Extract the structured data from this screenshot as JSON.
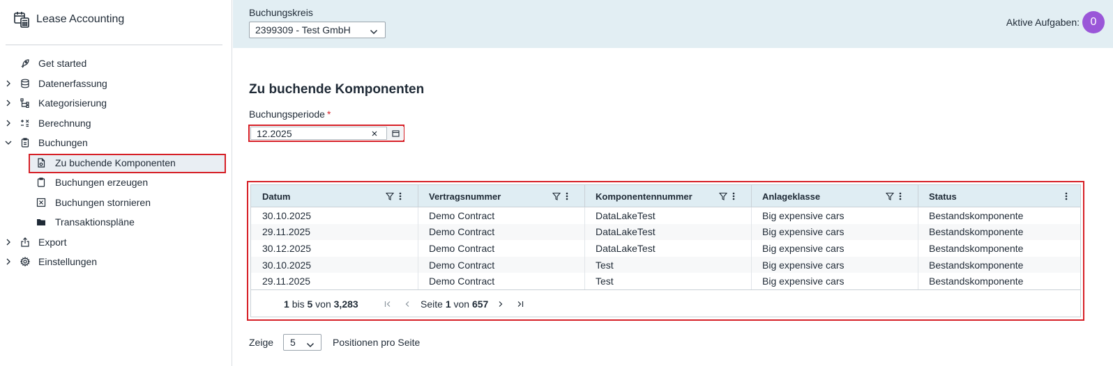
{
  "app": {
    "title": "Lease Accounting"
  },
  "sidebar": {
    "items": [
      {
        "label": "Get started",
        "icon": "rocket-icon",
        "expandable": false
      },
      {
        "label": "Datenerfassung",
        "icon": "database-icon",
        "expandable": true
      },
      {
        "label": "Kategorisierung",
        "icon": "hierarchy-icon",
        "expandable": true
      },
      {
        "label": "Berechnung",
        "icon": "calculator-icon",
        "expandable": true
      },
      {
        "label": "Buchungen",
        "icon": "clipboard-icon",
        "expandable": true,
        "expanded": true,
        "children": [
          {
            "label": "Zu buchende Komponenten",
            "icon": "document-icon",
            "active": true
          },
          {
            "label": "Buchungen erzeugen",
            "icon": "clipboard-icon"
          },
          {
            "label": "Buchungen stornieren",
            "icon": "x-square-icon"
          },
          {
            "label": "Transaktionspläne",
            "icon": "folder-icon"
          }
        ]
      },
      {
        "label": "Export",
        "icon": "upload-icon",
        "expandable": true
      },
      {
        "label": "Einstellungen",
        "icon": "gear-icon",
        "expandable": true
      }
    ]
  },
  "topbar": {
    "company_code_label": "Buchungskreis",
    "company_code_value": "2399309 - Test GmbH",
    "tasks_label": "Aktive Aufgaben:",
    "tasks_count": "0",
    "bg_color": "#e2eef3",
    "badge_color": "#9a56d8"
  },
  "main": {
    "title": "Zu buchende Komponenten",
    "period_label": "Buchungsperiode",
    "period_required_mark": "*",
    "period_value": "12.2025",
    "table": {
      "columns": [
        "Datum",
        "Vertragsnummer",
        "Komponentennummer",
        "Anlageklasse",
        "Status"
      ],
      "rows": [
        [
          "30.10.2025",
          "Demo Contract",
          "DataLakeTest",
          "Big expensive cars",
          "Bestandskomponente"
        ],
        [
          "29.11.2025",
          "Demo Contract",
          "DataLakeTest",
          "Big expensive cars",
          "Bestandskomponente"
        ],
        [
          "30.12.2025",
          "Demo Contract",
          "DataLakeTest",
          "Big expensive cars",
          "Bestandskomponente"
        ],
        [
          "30.10.2025",
          "Demo Contract",
          "Test",
          "Big expensive cars",
          "Bestandskomponente"
        ],
        [
          "29.11.2025",
          "Demo Contract",
          "Test",
          "Big expensive cars",
          "Bestandskomponente"
        ]
      ],
      "footer": {
        "from": "1",
        "bis": "bis",
        "to": "5",
        "von": "von",
        "total": "3,283",
        "page_word": "Seite",
        "page": "1",
        "of_word": "von",
        "pages": "657"
      }
    },
    "page_size": {
      "show_label": "Zeige",
      "value": "5",
      "after_label": "Positionen pro Seite"
    },
    "highlight_color": "#d61f26"
  }
}
